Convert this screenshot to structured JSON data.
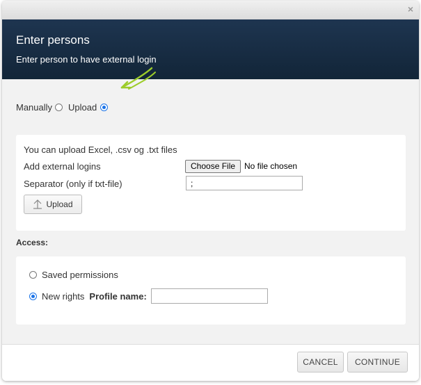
{
  "dialog": {
    "close_glyph": "×",
    "title": "Enter persons",
    "subtitle": "Enter person to have external login"
  },
  "mode": {
    "manually_label": "Manually",
    "upload_label": "Upload",
    "selected": "Upload"
  },
  "upload_panel": {
    "info_text": "You can upload Excel, .csv og .txt files",
    "add_logins_label": "Add external logins",
    "choose_file_label": "Choose File",
    "file_status": "No file chosen",
    "separator_label": "Separator (only if txt-file)",
    "separator_value": ";",
    "upload_button_label": "Upload"
  },
  "access": {
    "label": "Access:",
    "saved_permissions_label": "Saved permissions",
    "new_rights_label": "New rights",
    "profile_name_label": "Profile name:",
    "profile_name_value": "",
    "selected": "New rights"
  },
  "footer": {
    "cancel_label": "CANCEL",
    "continue_label": "CONTINUE"
  },
  "colors": {
    "header_bg": "#1b3149",
    "radio_accent": "#1a73e8",
    "annotation_arrow": "#9ccc2a"
  }
}
